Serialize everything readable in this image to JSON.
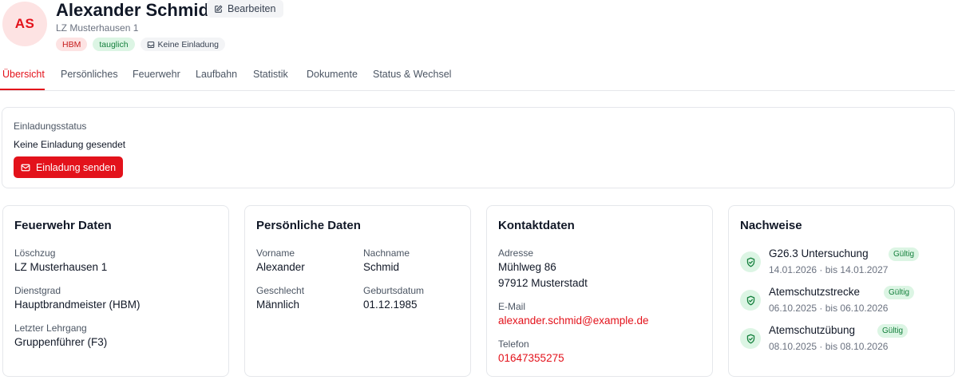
{
  "header": {
    "initials": "AS",
    "name": "Alexander Schmid",
    "edit_label": "Bearbeiten",
    "unit": "LZ Musterhausen 1",
    "badges": {
      "rank": "HBM",
      "fitness": "tauglich",
      "invite": "Keine Einladung"
    }
  },
  "tabs": [
    {
      "label": "Übersicht",
      "active": true
    },
    {
      "label": "Persönliches",
      "active": false
    },
    {
      "label": "Feuerwehr",
      "active": false
    },
    {
      "label": "Laufbahn",
      "active": false
    },
    {
      "label": "Statistik",
      "active": false
    },
    {
      "label": "Dokumente",
      "active": false
    },
    {
      "label": "Status & Wechsel",
      "active": false
    }
  ],
  "invite": {
    "label": "Einladungsstatus",
    "status": "Keine Einladung gesendet",
    "button_label": "Einladung senden"
  },
  "fire_data": {
    "title": "Feuerwehr Daten",
    "loeschzug_label": "Löschzug",
    "loeschzug_value": "LZ Musterhausen 1",
    "dienstgrad_label": "Dienstgrad",
    "dienstgrad_value": "Hauptbrandmeister (HBM)",
    "lehrgang_label": "Letzter Lehrgang",
    "lehrgang_value": "Gruppenführer (F3)"
  },
  "personal": {
    "title": "Persönliche Daten",
    "vorname_label": "Vorname",
    "vorname_value": "Alexander",
    "nachname_label": "Nachname",
    "nachname_value": "Schmid",
    "geschlecht_label": "Geschlecht",
    "geschlecht_value": "Männlich",
    "geburtsdatum_label": "Geburtsdatum",
    "geburtsdatum_value": "01.12.1985"
  },
  "contact": {
    "title": "Kontaktdaten",
    "adresse_label": "Adresse",
    "adresse_line1": "Mühlweg 86",
    "adresse_line2": "97912 Musterstadt",
    "email_label": "E-Mail",
    "email_value": "alexander.schmid@example.de",
    "telefon_label": "Telefon",
    "telefon_value": "01647355275"
  },
  "proofs": {
    "title": "Nachweise",
    "items": [
      {
        "title": "G26.3 Untersuchung",
        "status": "Gültig",
        "dates": "14.01.2026 · bis 14.01.2027",
        "icon": "shield-check-icon"
      },
      {
        "title": "Atemschutzstrecke",
        "status": "Gültig",
        "dates": "06.10.2025 · bis 06.10.2026",
        "icon": "shield-check-icon"
      },
      {
        "title": "Atemschutzübung",
        "status": "Gültig",
        "dates": "08.10.2025 · bis 08.10.2026",
        "icon": "shield-check-icon"
      }
    ]
  },
  "colors": {
    "accent": "#e3121b",
    "success": "#15803d",
    "success_bg": "#dcf5e4"
  }
}
